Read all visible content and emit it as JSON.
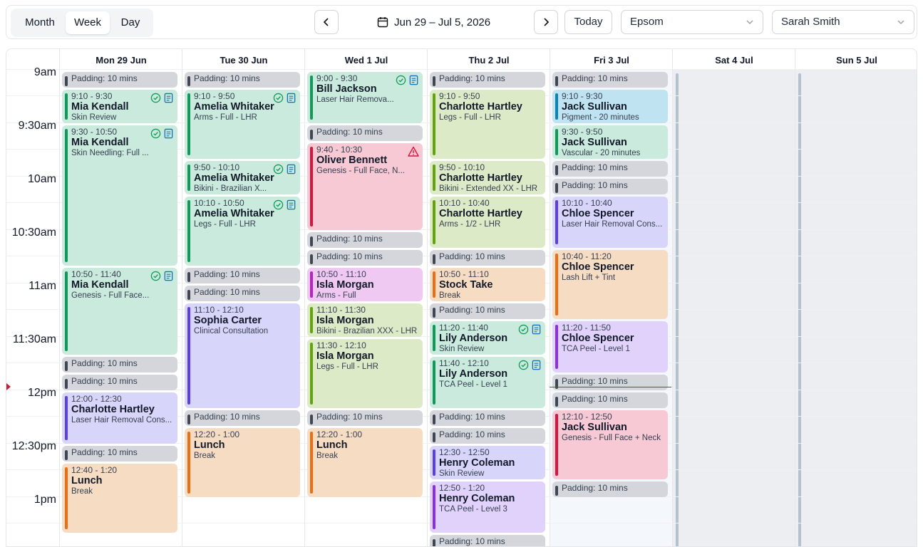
{
  "toolbar": {
    "views": [
      "Month",
      "Week",
      "Day"
    ],
    "active_view": "Week",
    "date_range": "Jun 29 – Jul 5, 2026",
    "today_label": "Today",
    "location": "Epsom",
    "staff": "Sarah Smith"
  },
  "days": [
    "Mon 29 Jun",
    "Tue 30 Jun",
    "Wed 1 Jul",
    "Thu 2 Jul",
    "Fri 3 Jul",
    "Sat 4 Jul",
    "Sun 5 Jul"
  ],
  "time_labels": [
    "9am",
    "9:30am",
    "10am",
    "10:30am",
    "11am",
    "11:30am",
    "12pm",
    "12:30pm",
    "1pm"
  ],
  "padding_label": "Padding: 10 mins",
  "events": {
    "mon": [
      {
        "time": "9:10 - 9:30",
        "name": "Mia Kendall",
        "service": "Skin Review"
      },
      {
        "time": "9:30 - 10:50",
        "name": "Mia Kendall",
        "service": "Skin Needling: Full ..."
      },
      {
        "time": "10:50 - 11:40",
        "name": "Mia Kendall",
        "service": "Genesis - Full Face..."
      },
      {
        "time": "12:00 - 12:30",
        "name": "Charlotte Hartley",
        "service": "Laser Hair Removal Cons..."
      },
      {
        "time": "12:40 - 1:20",
        "name": "Lunch",
        "service": "Break"
      }
    ],
    "tue": [
      {
        "time": "9:10 - 9:50",
        "name": "Amelia Whitaker",
        "service": "Arms - Full - LHR"
      },
      {
        "time": "9:50 - 10:10",
        "name": "Amelia Whitaker",
        "service": "Bikini - Brazilian X..."
      },
      {
        "time": "10:10 - 10:50",
        "name": "Amelia Whitaker",
        "service": "Legs - Full - LHR"
      },
      {
        "time": "11:10 - 12:10",
        "name": "Sophia Carter",
        "service": "Clinical Consultation"
      },
      {
        "time": "12:20 - 1:00",
        "name": "Lunch",
        "service": "Break"
      }
    ],
    "wed": [
      {
        "time": "9:00 - 9:30",
        "name": "Bill Jackson",
        "service": "Laser Hair Remova..."
      },
      {
        "time": "9:40 - 10:30",
        "name": "Oliver Bennett",
        "service": "Genesis - Full Face, N..."
      },
      {
        "time": "10:50 - 11:10",
        "name": "Isla Morgan",
        "service": "Arms - Full"
      },
      {
        "time": "11:10 - 11:30",
        "name": "Isla Morgan",
        "service": "Bikini - Brazilian XXX - LHR"
      },
      {
        "time": "11:30 - 12:10",
        "name": "Isla Morgan",
        "service": "Legs - Full - LHR"
      },
      {
        "time": "12:20 - 1:00",
        "name": "Lunch",
        "service": "Break"
      }
    ],
    "thu": [
      {
        "time": "9:10 - 9:50",
        "name": "Charlotte Hartley",
        "service": "Legs - Full - LHR"
      },
      {
        "time": "9:50 - 10:10",
        "name": "Charlotte Hartley",
        "service": "Bikini - Extended XX - LHR"
      },
      {
        "time": "10:10 - 10:40",
        "name": "Charlotte Hartley",
        "service": "Arms - 1/2 - LHR"
      },
      {
        "time": "10:50 - 11:10",
        "name": "Stock Take",
        "service": "Break"
      },
      {
        "time": "11:20 - 11:40",
        "name": "Lily Anderson",
        "service": "Skin Review"
      },
      {
        "time": "11:40 - 12:10",
        "name": "Lily Anderson",
        "service": "TCA Peel - Level 1"
      },
      {
        "time": "12:30 - 12:50",
        "name": "Henry Coleman",
        "service": "Skin Review"
      },
      {
        "time": "12:50 - 1:20",
        "name": "Henry Coleman",
        "service": "TCA Peel - Level 3"
      }
    ],
    "fri": [
      {
        "time": "9:10 - 9:30",
        "name": "Jack Sullivan",
        "service": "Pigment - 20 minutes"
      },
      {
        "time": "9:30 - 9:50",
        "name": "Jack Sullivan",
        "service": "Vascular - 20 minutes"
      },
      {
        "time": "10:10 - 10:40",
        "name": "Chloe Spencer",
        "service": "Laser Hair Removal Cons..."
      },
      {
        "time": "10:40 - 11:20",
        "name": "Chloe Spencer",
        "service": "Lash Lift + Tint"
      },
      {
        "time": "11:20 - 11:50",
        "name": "Chloe Spencer",
        "service": "TCA Peel - Level 1"
      },
      {
        "time": "12:10 - 12:50",
        "name": "Jack Sullivan",
        "service": "Genesis - Full Face + Neck"
      }
    ]
  },
  "colors": {
    "green_bg": "#c9eadc",
    "green_bar": "#0f9a5a",
    "lime_bg": "#dceac8",
    "lime_bar": "#65a30d",
    "purple_bg": "#d8d5fa",
    "purple_bar": "#5b3fe0",
    "violet_bg": "#e0d2fb",
    "violet_bar": "#8b2fe0",
    "orange_bg": "#f7dcc4",
    "orange_bar": "#ea6f14",
    "pink_bg": "#f7c9d5",
    "pink_bar": "#d6173d",
    "magenta_bg": "#efc9f2",
    "magenta_bar": "#b424c8",
    "blue_bg": "#bfe3f0",
    "blue_bar": "#0b83b8",
    "pad_bg": "#d4d6db",
    "pad_bar": "#3f4654",
    "now": "#c81e3a"
  }
}
